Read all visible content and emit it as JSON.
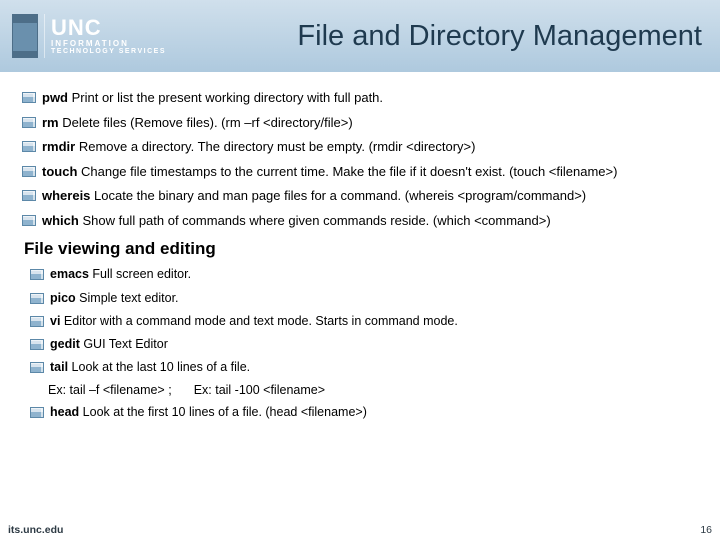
{
  "logo": {
    "brand": "UNC",
    "line1": "INFORMATION",
    "line2": "TECHNOLOGY SERVICES"
  },
  "title": "File and Directory Management",
  "section1": [
    {
      "cmd": "pwd",
      "desc": " Print or list the present working directory with full path."
    },
    {
      "cmd": "rm",
      "desc": " Delete files (Remove files). (rm –rf <directory/file>)"
    },
    {
      "cmd": "rmdir",
      "desc": " Remove a directory. The directory must be empty. (rmdir <directory>)"
    },
    {
      "cmd": "touch",
      "desc": " Change file timestamps to the current time. Make the file if it doesn't exist. (touch <filename>)"
    },
    {
      "cmd": "whereis",
      "desc": " Locate the binary and man page files for a command. (whereis <program/command>)"
    },
    {
      "cmd": "which",
      "desc": " Show full path of commands where given commands reside. (which <command>)"
    }
  ],
  "subheading": "File viewing and editing",
  "section2": [
    {
      "cmd": "emacs",
      "desc": " Full screen editor."
    },
    {
      "cmd": "pico",
      "desc": " Simple text editor."
    },
    {
      "cmd": "vi",
      "desc": " Editor with a command mode and text mode. Starts in command mode."
    },
    {
      "cmd": "gedit",
      "desc": " GUI Text Editor"
    },
    {
      "cmd": "tail",
      "desc": " Look at the last 10 lines of a file."
    }
  ],
  "example": {
    "a": "Ex: tail –f <filename> ;",
    "b": "Ex: tail -100 <filename>"
  },
  "section3": [
    {
      "cmd": "head",
      "desc": " Look at the first 10 lines of a file. (head <filename>)"
    }
  ],
  "footer": {
    "url": "its.unc.edu",
    "page": "16"
  }
}
